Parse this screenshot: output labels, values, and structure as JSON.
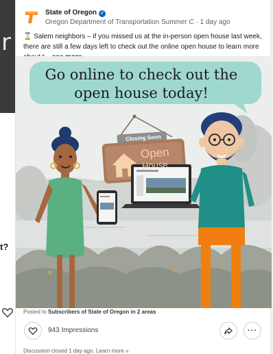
{
  "background": {
    "photo_glyph": "r",
    "question_fragment": "t?"
  },
  "post": {
    "author": "State of Oregon",
    "author_subtitle": "Oregon Department of Transportation Summer C · 1 day ago",
    "body": "Salem neighbors – if you missed us at the in-person open house last week, there are still a few days left to check out the online open house to learn more about t...",
    "see_more": "see more",
    "image": {
      "speech_bubble": "Go online to check out the open house today!",
      "sign_top": "Closing Soon",
      "sign_main": "Open",
      "sign_sub": "House"
    },
    "posted_to_prefix": "Posted to",
    "posted_to_audience": "Subscribers of State of Oregon in 2 areas",
    "impressions": "943 Impressions",
    "more_label": "···",
    "footer": "Discussion closed 1 day ago. Learn more »"
  },
  "icons": {
    "logo": "oregon-t-logo",
    "verified": "verified-badge-icon",
    "hourglass": "hourglass-icon",
    "like": "heart-icon",
    "share": "share-arrow-icon",
    "more": "more-dots-icon"
  },
  "colors": {
    "brand_orange": "#f58a1f",
    "verified_blue": "#0a66c2",
    "bubble": "#9fd8cf",
    "woman_dress": "#59b082",
    "man_shirt": "#1f8f87",
    "man_pants": "#f07f10"
  }
}
